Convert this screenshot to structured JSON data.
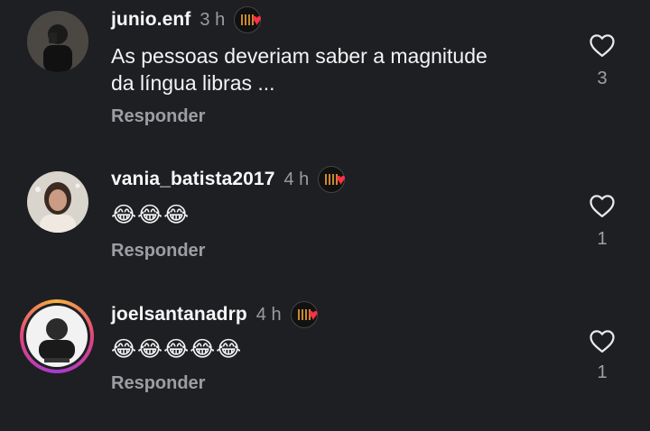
{
  "comments": [
    {
      "username": "junio.enf",
      "time": "3 h",
      "text_line1": "As pessoas deveriam saber a magnitude",
      "text_line2": "da língua libras ...",
      "reply": "Responder",
      "likes": "3",
      "liked_by_creator": true
    },
    {
      "username": "vania_batista2017",
      "time": "4 h",
      "text_line1": "😂😂😂",
      "reply": "Responder",
      "likes": "1",
      "liked_by_creator": true
    },
    {
      "username": "joelsantanadrp",
      "time": "4 h",
      "text_line1": "😂😂😂😂😂",
      "reply": "Responder",
      "likes": "1",
      "liked_by_creator": true,
      "has_story_ring": true
    }
  ],
  "colors": {
    "background": "#1e1f23",
    "secondary_text": "#9d9ea3",
    "heart_badge": "#ff2f45"
  },
  "icons": [
    "heart-outline-icon",
    "creator-liked-badge-icon"
  ]
}
